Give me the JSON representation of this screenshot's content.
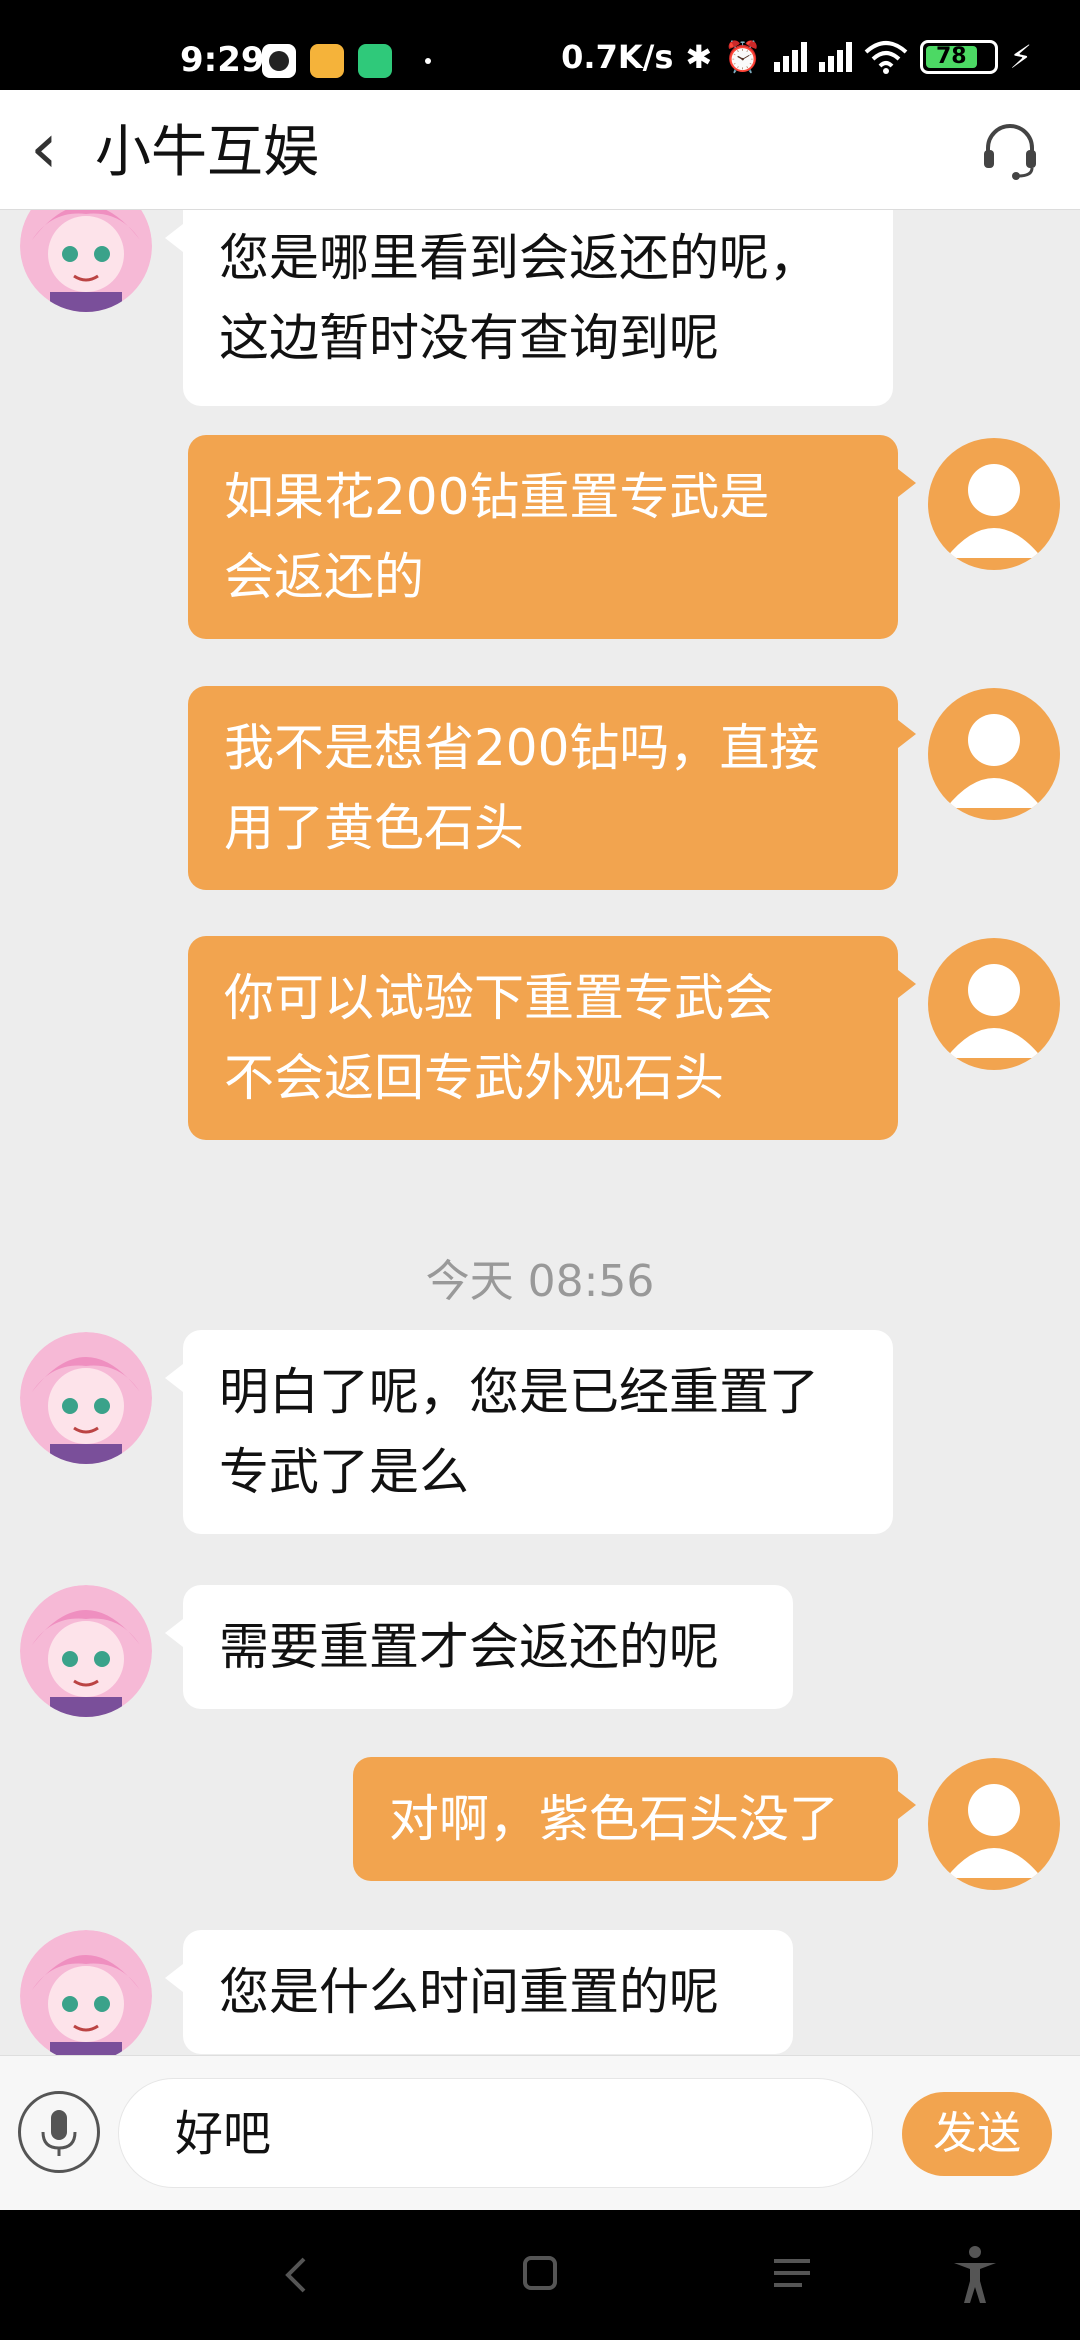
{
  "status_bar": {
    "time": "9:29",
    "network_speed": "0.7K/s",
    "battery_level": "78",
    "icons": [
      "camera-app-icon",
      "notes-app-icon",
      "security-app-icon",
      "bluetooth-icon",
      "alarm-icon",
      "signal-icon",
      "wifi-icon",
      "battery-icon",
      "charging-icon"
    ]
  },
  "header": {
    "back_symbol": "‹",
    "title": "小牛互娱",
    "support_icon": "headset-icon"
  },
  "messages": [
    {
      "side": "in",
      "lines": [
        "您是哪里看到会返还的呢，",
        "这边暂时没有查询到呢"
      ]
    },
    {
      "side": "out",
      "lines": [
        "如果花200钻重置专武是",
        "会返还的"
      ]
    },
    {
      "side": "out",
      "lines": [
        "我不是想省200钻吗，直接",
        "用了黄色石头"
      ]
    },
    {
      "side": "out",
      "lines": [
        "你可以试验下重置专武会",
        "不会返回专武外观石头"
      ]
    },
    {
      "side": "in",
      "lines": [
        "明白了呢，您是已经重置了",
        "专武了是么"
      ]
    },
    {
      "side": "in",
      "lines": [
        "需要重置才会返还的呢"
      ]
    },
    {
      "side": "out",
      "lines": [
        "对啊，紫色石头没了"
      ]
    },
    {
      "side": "in",
      "lines": [
        "您是什么时间重置的呢"
      ]
    }
  ],
  "timestamp": "今天 08:56",
  "input_bar": {
    "voice_icon": "microphone-icon",
    "input_value": "好吧",
    "send_label": "发送"
  },
  "nav_bar": {
    "icons": [
      "back-nav-icon",
      "home-nav-icon",
      "recents-nav-icon",
      "accessibility-icon"
    ]
  },
  "colors": {
    "accent": "#f2a44f",
    "chat_background": "#ededed"
  }
}
